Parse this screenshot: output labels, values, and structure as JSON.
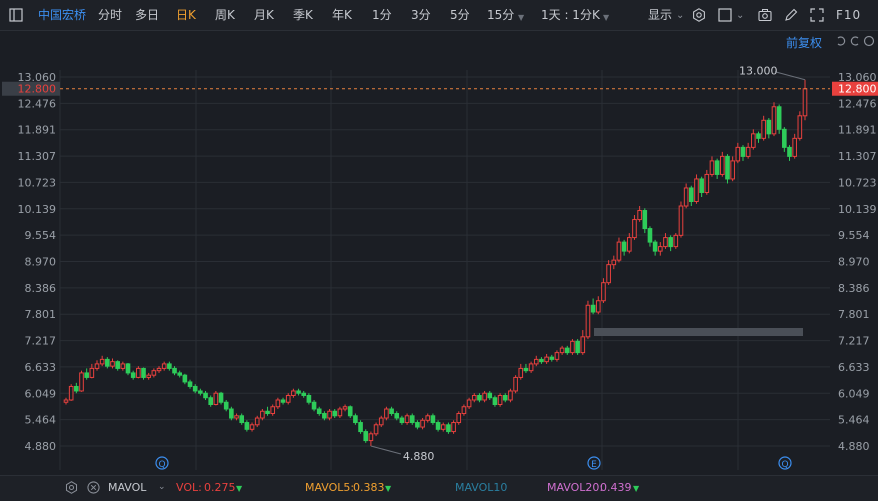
{
  "toolbar": {
    "stock_name": "中国宏桥",
    "periods": [
      "分时",
      "多日",
      "日K",
      "周K",
      "月K",
      "季K",
      "年K",
      "1分",
      "3分",
      "5分",
      "15分",
      "1天 : 1分K"
    ],
    "active_period": "日K",
    "display_label": "显示",
    "f10_label": "F10",
    "adjust_label": "前复权"
  },
  "chart_data": {
    "type": "candlestick",
    "title": "",
    "y_ticks": [
      13.06,
      12.476,
      11.891,
      11.307,
      10.723,
      10.139,
      9.554,
      8.97,
      8.386,
      7.801,
      7.217,
      6.633,
      6.049,
      5.464,
      4.88
    ],
    "y_tick_labels": [
      "13.060",
      "12.476",
      "11.891",
      "11.307",
      "10.723",
      "10.139",
      "9.554",
      "8.970",
      "8.386",
      "7.801",
      "7.217",
      "6.633",
      "6.049",
      "5.464",
      "4.880"
    ],
    "ylim": [
      4.88,
      13.06
    ],
    "current_price": 12.8,
    "current_price_label": "12.800",
    "max_label": "13.000",
    "min_label": "4.880",
    "candles": [
      [
        5.85,
        5.9,
        5.95,
        5.8
      ],
      [
        5.9,
        6.2,
        6.25,
        5.88
      ],
      [
        6.2,
        6.1,
        6.28,
        6.05
      ],
      [
        6.1,
        6.5,
        6.55,
        6.08
      ],
      [
        6.5,
        6.4,
        6.6,
        6.35
      ],
      [
        6.4,
        6.6,
        6.7,
        6.38
      ],
      [
        6.6,
        6.7,
        6.78,
        6.55
      ],
      [
        6.7,
        6.8,
        6.88,
        6.65
      ],
      [
        6.8,
        6.65,
        6.85,
        6.6
      ],
      [
        6.65,
        6.75,
        6.82,
        6.6
      ],
      [
        6.75,
        6.6,
        6.78,
        6.55
      ],
      [
        6.6,
        6.7,
        6.75,
        6.55
      ],
      [
        6.7,
        6.5,
        6.72,
        6.45
      ],
      [
        6.5,
        6.4,
        6.55,
        6.35
      ],
      [
        6.4,
        6.6,
        6.65,
        6.38
      ],
      [
        6.6,
        6.4,
        6.62,
        6.35
      ],
      [
        6.4,
        6.45,
        6.5,
        6.35
      ],
      [
        6.45,
        6.55,
        6.6,
        6.4
      ],
      [
        6.55,
        6.6,
        6.65,
        6.5
      ],
      [
        6.6,
        6.7,
        6.75,
        6.55
      ],
      [
        6.7,
        6.6,
        6.75,
        6.55
      ],
      [
        6.6,
        6.5,
        6.65,
        6.45
      ],
      [
        6.5,
        6.45,
        6.55,
        6.4
      ],
      [
        6.45,
        6.3,
        6.48,
        6.25
      ],
      [
        6.3,
        6.2,
        6.35,
        6.15
      ],
      [
        6.2,
        6.1,
        6.25,
        6.05
      ],
      [
        6.1,
        6.05,
        6.15,
        6.0
      ],
      [
        6.05,
        5.95,
        6.1,
        5.9
      ],
      [
        5.95,
        5.8,
        6.0,
        5.75
      ],
      [
        5.8,
        6.05,
        6.1,
        5.78
      ],
      [
        6.05,
        5.85,
        6.08,
        5.8
      ],
      [
        5.85,
        5.7,
        5.9,
        5.65
      ],
      [
        5.7,
        5.5,
        5.75,
        5.45
      ],
      [
        5.5,
        5.55,
        5.6,
        5.45
      ],
      [
        5.55,
        5.4,
        5.6,
        5.35
      ],
      [
        5.4,
        5.25,
        5.45,
        5.2
      ],
      [
        5.25,
        5.35,
        5.4,
        5.2
      ],
      [
        5.35,
        5.5,
        5.55,
        5.3
      ],
      [
        5.5,
        5.65,
        5.7,
        5.45
      ],
      [
        5.65,
        5.6,
        5.75,
        5.55
      ],
      [
        5.6,
        5.75,
        5.8,
        5.55
      ],
      [
        5.75,
        5.9,
        5.95,
        5.7
      ],
      [
        5.9,
        5.85,
        5.95,
        5.8
      ],
      [
        5.85,
        6.0,
        6.05,
        5.8
      ],
      [
        6.0,
        6.1,
        6.15,
        5.95
      ],
      [
        6.1,
        6.05,
        6.15,
        6.0
      ],
      [
        6.05,
        6.0,
        6.1,
        5.95
      ],
      [
        6.0,
        5.85,
        6.05,
        5.8
      ],
      [
        5.85,
        5.7,
        5.9,
        5.65
      ],
      [
        5.7,
        5.6,
        5.75,
        5.55
      ],
      [
        5.6,
        5.5,
        5.65,
        5.45
      ],
      [
        5.5,
        5.65,
        5.7,
        5.45
      ],
      [
        5.65,
        5.55,
        5.7,
        5.5
      ],
      [
        5.55,
        5.7,
        5.75,
        5.5
      ],
      [
        5.7,
        5.75,
        5.8,
        5.65
      ],
      [
        5.75,
        5.55,
        5.78,
        5.5
      ],
      [
        5.55,
        5.4,
        5.6,
        5.35
      ],
      [
        5.4,
        5.2,
        5.45,
        5.15
      ],
      [
        5.2,
        5.0,
        5.25,
        4.95
      ],
      [
        5.0,
        5.15,
        5.2,
        4.88
      ],
      [
        5.15,
        5.35,
        5.4,
        5.1
      ],
      [
        5.35,
        5.5,
        5.55,
        5.3
      ],
      [
        5.5,
        5.7,
        5.75,
        5.45
      ],
      [
        5.7,
        5.6,
        5.75,
        5.55
      ],
      [
        5.6,
        5.5,
        5.65,
        5.45
      ],
      [
        5.5,
        5.4,
        5.55,
        5.35
      ],
      [
        5.4,
        5.55,
        5.6,
        5.35
      ],
      [
        5.55,
        5.4,
        5.6,
        5.35
      ],
      [
        5.4,
        5.3,
        5.45,
        5.25
      ],
      [
        5.3,
        5.45,
        5.5,
        5.25
      ],
      [
        5.45,
        5.55,
        5.6,
        5.4
      ],
      [
        5.55,
        5.4,
        5.6,
        5.35
      ],
      [
        5.4,
        5.25,
        5.45,
        5.2
      ],
      [
        5.25,
        5.35,
        5.4,
        5.2
      ],
      [
        5.35,
        5.2,
        5.4,
        5.15
      ],
      [
        5.2,
        5.4,
        5.45,
        5.15
      ],
      [
        5.4,
        5.6,
        5.65,
        5.35
      ],
      [
        5.6,
        5.75,
        5.8,
        5.55
      ],
      [
        5.75,
        5.9,
        5.95,
        5.7
      ],
      [
        5.9,
        6.0,
        6.05,
        5.85
      ],
      [
        6.0,
        5.9,
        6.05,
        5.85
      ],
      [
        5.9,
        6.05,
        6.1,
        5.85
      ],
      [
        6.05,
        5.95,
        6.1,
        5.9
      ],
      [
        5.95,
        5.8,
        6.0,
        5.75
      ],
      [
        5.8,
        6.0,
        6.05,
        5.75
      ],
      [
        6.0,
        5.9,
        6.05,
        5.85
      ],
      [
        5.9,
        6.1,
        6.15,
        5.85
      ],
      [
        6.1,
        6.4,
        6.45,
        6.05
      ],
      [
        6.4,
        6.6,
        6.7,
        6.35
      ],
      [
        6.6,
        6.55,
        6.7,
        6.5
      ],
      [
        6.55,
        6.7,
        6.75,
        6.5
      ],
      [
        6.7,
        6.8,
        6.88,
        6.65
      ],
      [
        6.8,
        6.75,
        6.85,
        6.7
      ],
      [
        6.75,
        6.85,
        6.92,
        6.7
      ],
      [
        6.85,
        6.8,
        6.9,
        6.75
      ],
      [
        6.8,
        6.95,
        7.0,
        6.75
      ],
      [
        6.95,
        7.05,
        7.1,
        6.9
      ],
      [
        7.05,
        6.95,
        7.1,
        6.9
      ],
      [
        6.95,
        7.2,
        7.25,
        6.9
      ],
      [
        7.2,
        6.95,
        7.25,
        6.9
      ],
      [
        6.95,
        7.3,
        7.45,
        6.9
      ],
      [
        7.3,
        8.0,
        8.1,
        7.25
      ],
      [
        8.0,
        7.85,
        8.15,
        7.8
      ],
      [
        7.85,
        8.1,
        8.2,
        7.8
      ],
      [
        8.1,
        8.5,
        8.6,
        8.05
      ],
      [
        8.5,
        8.9,
        9.0,
        8.45
      ],
      [
        8.9,
        9.0,
        9.1,
        8.8
      ],
      [
        9.0,
        9.4,
        9.5,
        8.95
      ],
      [
        9.4,
        9.2,
        9.45,
        9.1
      ],
      [
        9.2,
        9.5,
        9.6,
        9.15
      ],
      [
        9.5,
        9.9,
        10.0,
        9.45
      ],
      [
        9.9,
        10.1,
        10.2,
        9.85
      ],
      [
        10.1,
        9.7,
        10.15,
        9.6
      ],
      [
        9.7,
        9.4,
        9.75,
        9.3
      ],
      [
        9.4,
        9.2,
        9.45,
        9.1
      ],
      [
        9.2,
        9.3,
        9.4,
        9.1
      ],
      [
        9.3,
        9.5,
        9.6,
        9.25
      ],
      [
        9.5,
        9.3,
        9.55,
        9.2
      ],
      [
        9.3,
        9.55,
        9.6,
        9.25
      ],
      [
        9.55,
        10.2,
        10.3,
        9.5
      ],
      [
        10.2,
        10.6,
        10.7,
        10.15
      ],
      [
        10.6,
        10.3,
        10.65,
        10.2
      ],
      [
        10.3,
        10.8,
        10.9,
        10.25
      ],
      [
        10.8,
        10.5,
        10.85,
        10.4
      ],
      [
        10.5,
        10.9,
        11.0,
        10.45
      ],
      [
        10.9,
        11.2,
        11.3,
        10.85
      ],
      [
        11.2,
        10.9,
        11.25,
        10.8
      ],
      [
        10.9,
        11.3,
        11.4,
        10.85
      ],
      [
        11.3,
        10.8,
        11.35,
        10.7
      ],
      [
        10.8,
        11.2,
        11.3,
        10.75
      ],
      [
        11.2,
        11.5,
        11.6,
        11.15
      ],
      [
        11.5,
        11.3,
        11.55,
        11.2
      ],
      [
        11.3,
        11.5,
        11.6,
        11.25
      ],
      [
        11.5,
        11.8,
        11.9,
        11.45
      ],
      [
        11.8,
        11.7,
        11.85,
        11.6
      ],
      [
        11.7,
        12.1,
        12.2,
        11.65
      ],
      [
        12.1,
        11.8,
        12.15,
        11.7
      ],
      [
        11.8,
        12.4,
        12.5,
        11.75
      ],
      [
        12.4,
        11.9,
        12.45,
        11.8
      ],
      [
        11.9,
        11.5,
        11.95,
        11.4
      ],
      [
        11.5,
        11.3,
        11.55,
        11.2
      ],
      [
        11.3,
        11.7,
        11.8,
        11.25
      ],
      [
        11.7,
        12.2,
        12.3,
        11.65
      ],
      [
        12.2,
        12.8,
        13.0,
        12.1
      ]
    ],
    "markers": [
      "Q",
      "E",
      "Q"
    ]
  },
  "indicators": {
    "mavol_label": "MAVOL",
    "vol_label": "VOL:",
    "vol_value": "0.275",
    "mavol5_label": "MAVOL5:",
    "mavol5_value": "0.383",
    "mavol10_label": "MAVOL10",
    "mavol20_label": "MAVOL20:",
    "mavol20_value": "0.439"
  },
  "colors": {
    "up": "#e8413e",
    "down": "#2ecc5a",
    "accent": "#f0a030",
    "blue": "#3c8ff0",
    "vol": "#e8413e",
    "mavol5": "#f0a030",
    "mavol10": "#2a7fa0",
    "mavol20": "#d070d0"
  }
}
